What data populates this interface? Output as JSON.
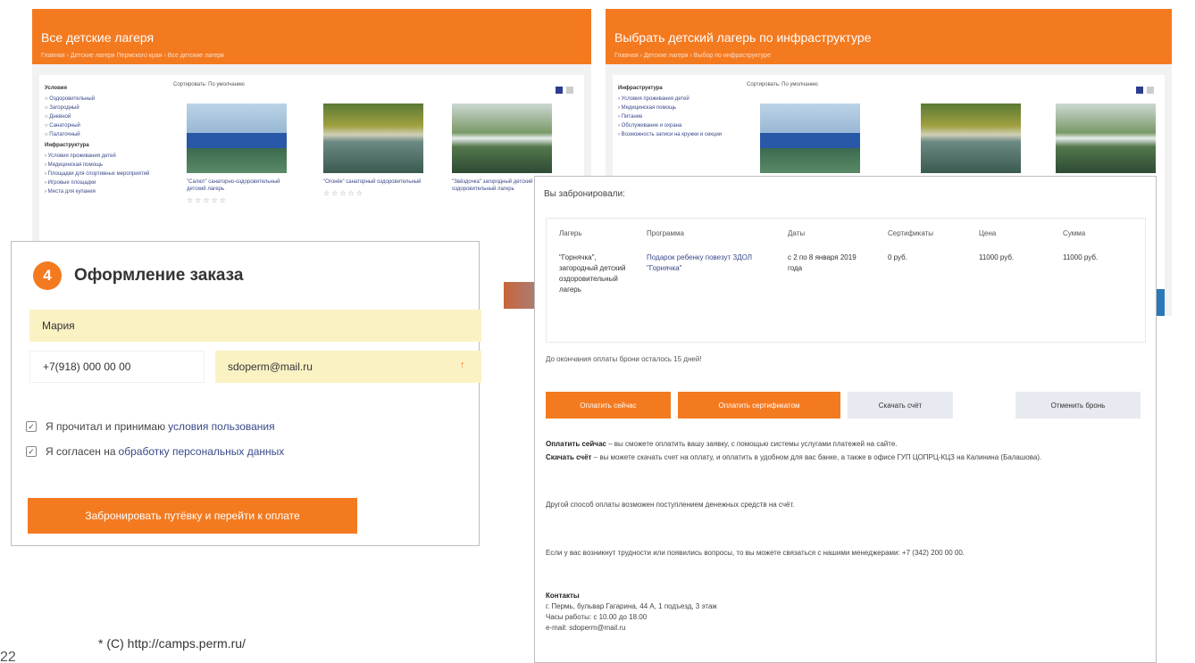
{
  "left_shot": {
    "title": "Все детские лагеря",
    "breadcrumb": "Главная › Детские лагеря Пермского края › Все детские лагеря",
    "side_groups": [
      {
        "heading": "Условия",
        "items": [
          "○ Оздоровительный",
          "○ Загородный",
          "○ Дневной",
          "○ Санаторный",
          "○ Палаточный"
        ]
      },
      {
        "heading": "Инфраструктура",
        "items": [
          "› Условия проживания детей",
          "› Медицинская помощь",
          "› Площадки для спортивных мероприятий",
          "› Игровые площадки",
          "› Места для купания"
        ]
      }
    ],
    "filter": "Сортировать: По умолчанию",
    "camps": [
      {
        "caption": "\"Салют\" санаторно-оздоровительный детский лагерь",
        "stars": "☆☆☆☆☆"
      },
      {
        "caption": "\"Огонёк\" санаторный оздоровительный",
        "stars": "☆☆☆☆☆"
      },
      {
        "caption": "\"Звёздочка\" загородный детский оздоровительный лагерь",
        "stars": ""
      }
    ]
  },
  "right_shot": {
    "title": "Выбрать детский лагерь по инфраструктуре",
    "breadcrumb": "Главная › Детские лагеря › Выбор по инфраструктуре",
    "side_heading": "Инфраструктура",
    "side_items": [
      "› Условия проживания детей",
      "› Медицинская помощь",
      "› Питание",
      "› Обслуживание и охрана",
      "› Возможность записи на кружки и секции"
    ],
    "filter": "Сортировать: По умолчанию"
  },
  "order": {
    "step": "4",
    "title": "Оформление заказа",
    "name_value": "Мария",
    "phone_value": "+7(918) 000 00 00",
    "email_value": "sdoperm@mail.ru",
    "terms_label": "Я прочитал и принимаю",
    "terms_link": "условия пользования",
    "consent_label": "Я согласен на",
    "consent_link": "обработку персональных данных",
    "submit_label": "Забронировать путёвку и перейти к оплате"
  },
  "booking": {
    "heading": "Вы забронировали:",
    "columns": [
      "Лагерь",
      "Программа",
      "Даты",
      "Сертификаты",
      "Цена",
      "Сумма"
    ],
    "row": {
      "camp": "\"Горнячка\", загородный детский оздоровительный лагерь",
      "program": "Подарок ребенку повезут ЗДОЛ \"Горнячка\"",
      "dates": "с 2 по 8 января 2019 года",
      "certificates": "0 руб.",
      "price": "11000 руб.",
      "total": "11000 руб."
    },
    "deadline": "До окончания оплаты брони осталось 15 дней!",
    "buttons": {
      "pay_now": "Оплатить сейчас",
      "pay_certificate": "Оплатить сертификатом",
      "download_invoice": "Скачать счёт",
      "cancel_booking": "Отменить бронь"
    },
    "note_pay_now_bold": "Оплатить сейчас",
    "note_pay_now": " – вы сможете оплатить вашу заявку, с помощью системы услугами платежей на сайте.",
    "note_invoice_bold": "Скачать счёт",
    "note_invoice": " – вы можете скачать счет на оплату, и оплатить в удобном для вас банке, а также в офисе ГУП ЦОПРЦ-КЦЗ на Калинина (Балашова).",
    "note_other": "Другой способ оплаты возможен поступлением денежных средств на счёт.",
    "note_contact": "Если у вас возникнут трудности или появились вопросы, то вы можете связаться с нашими менеджерами: +7 (342) 200 00 00.",
    "contacts_heading": "Контакты",
    "contacts_address": "г. Пермь, бульвар Гагарина, 44 А, 1 подъезд, 3 этаж",
    "contacts_hours": "Часы работы: с 10.00 до 18.00",
    "contacts_email": "e-mail: sdoperm@mail.ru"
  },
  "footnote": "*  (C) http://camps.perm.ru/",
  "page_number": "22"
}
